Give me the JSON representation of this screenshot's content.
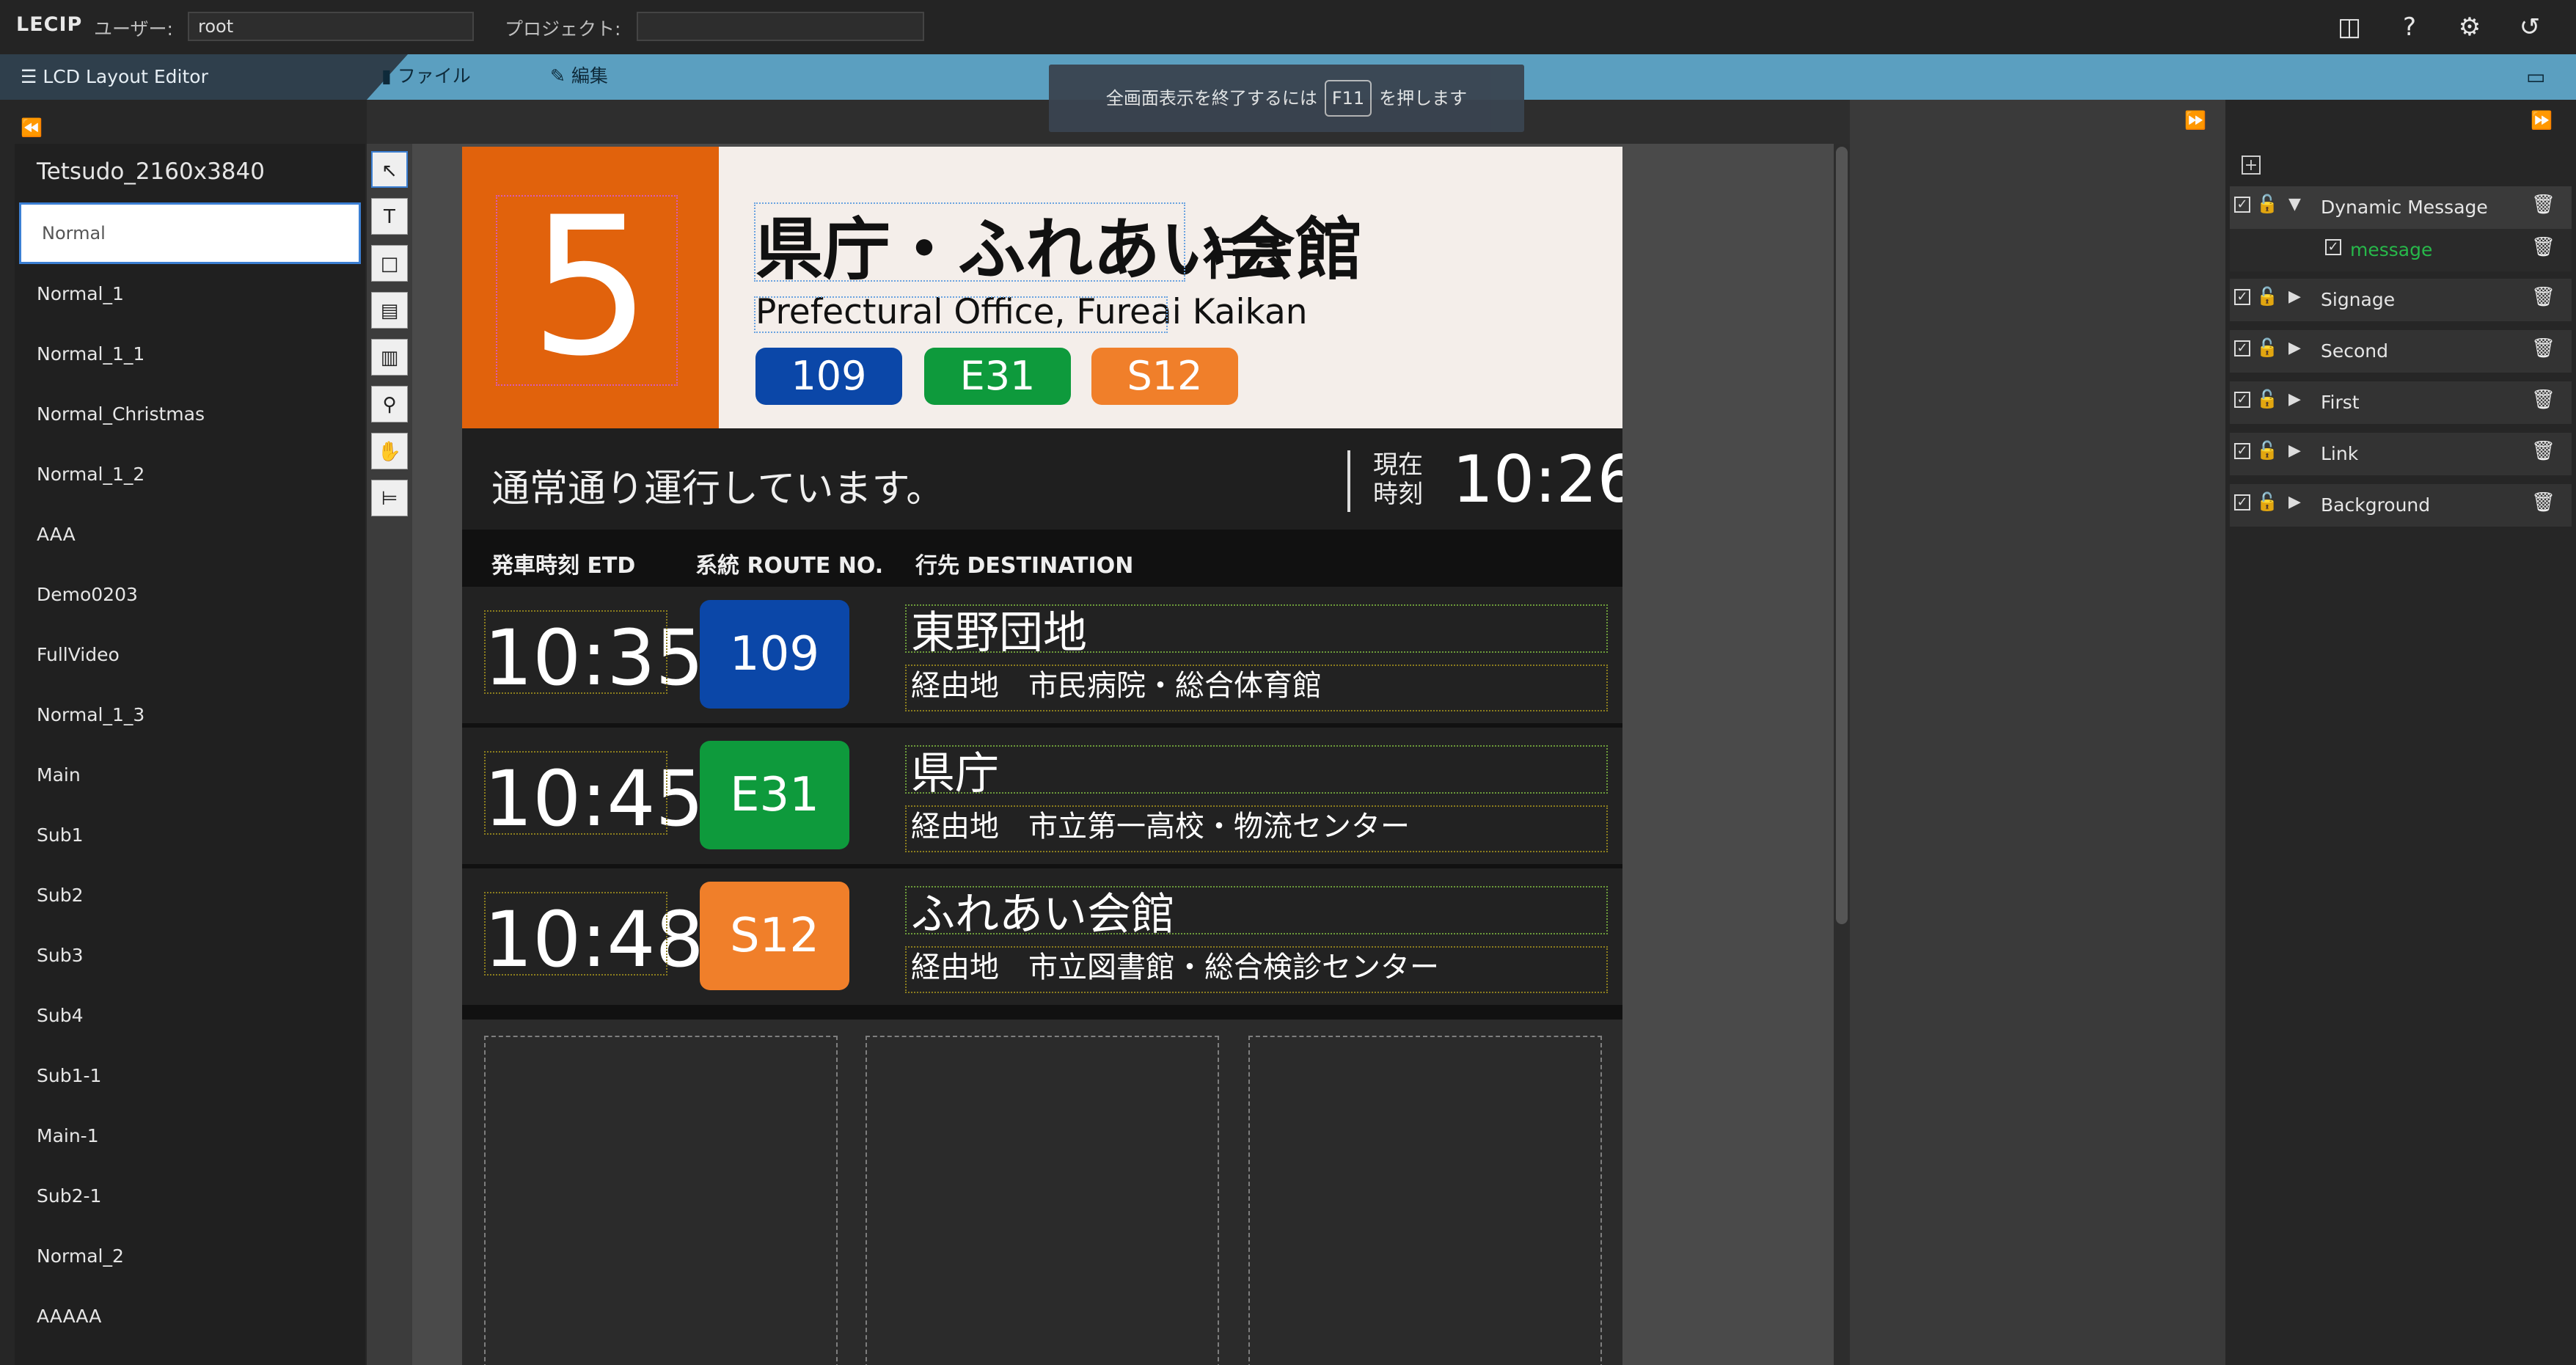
{
  "topbar": {
    "brand": "LECIP",
    "user_label": "ユーザー:",
    "user_value": "root",
    "project_label": "プロジェクト:",
    "project_value": "",
    "icons": [
      "book-icon",
      "help-icon",
      "gear-icon",
      "logout-icon"
    ]
  },
  "menubar": {
    "editor_title": "LCD Layout Editor",
    "file_label": "ファイル",
    "edit_label": "編集",
    "hint_pre": "全画面表示を終了するには",
    "hint_key": "F11",
    "hint_post": "を押します"
  },
  "layouts": {
    "title": "Tetsudo_2160x3840",
    "input_value": "Normal",
    "items": [
      "Normal_1",
      "Normal_1_1",
      "Normal_Christmas",
      "Normal_1_2",
      "AAA",
      "Demo0203",
      "FullVideo",
      "Normal_1_3",
      "Main",
      "Sub1",
      "Sub2",
      "Sub3",
      "Sub4",
      "Sub1-1",
      "Main-1",
      "Sub2-1",
      "Normal_2",
      "AAAAA"
    ]
  },
  "tools": [
    "select-arrow-icon",
    "text-tool-icon",
    "area-tool-icon",
    "window-tool-icon",
    "region-tool-icon",
    "zoom-icon",
    "hand-icon",
    "align-left-icon"
  ],
  "layers": {
    "dynamic_message": "Dynamic Message",
    "message": "message",
    "items": [
      "Signage",
      "Second",
      "First",
      "Link",
      "Background"
    ]
  },
  "signage": {
    "platform": "5",
    "destination_ja": "県庁・ふれあい会館",
    "destination_suffix": "行き",
    "destination_en": "Prefectural Office, Fureai Kaikan",
    "badges": [
      {
        "label": "109",
        "color": "#0b47a8"
      },
      {
        "label": "E31",
        "color": "#0e9a3c"
      },
      {
        "label": "S12",
        "color": "#f07f2a"
      }
    ],
    "status": "通常通り運行しています。",
    "now_label_1": "現在",
    "now_label_2": "時刻",
    "now_time": "10:26",
    "headers": {
      "etd": "発車時刻 ETD",
      "route": "系統 ROUTE NO.",
      "dest": "行先 DESTINATION"
    },
    "rows": [
      {
        "time": "10:35",
        "route": "109",
        "route_color": "#0b47a8",
        "dest": "東野団地",
        "via": "経由地　市民病院・総合体育館"
      },
      {
        "time": "10:45",
        "route": "E31",
        "route_color": "#0e9a3c",
        "dest": "県庁",
        "via": "経由地　市立第一高校・物流センター"
      },
      {
        "time": "10:48",
        "route": "S12",
        "route_color": "#f07f2a",
        "dest": "ふれあい会館",
        "via": "経由地　市立図書館・総合検診センター"
      }
    ]
  }
}
